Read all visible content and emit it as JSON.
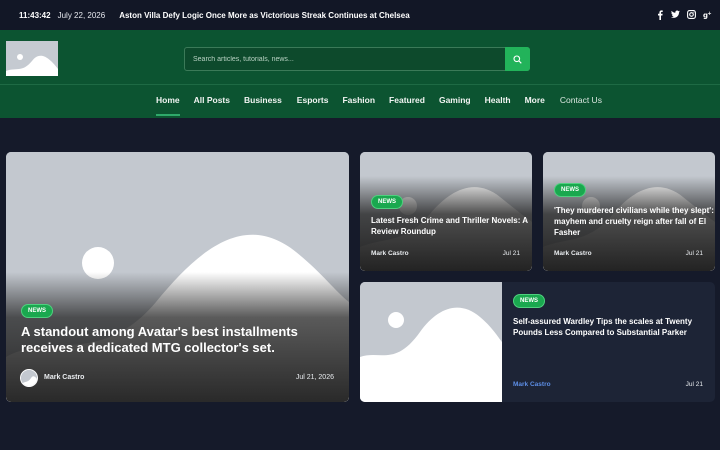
{
  "topbar": {
    "time": "11:43:42",
    "date": "July 22, 2026",
    "headline": "Aston Villa Defy Logic Once More as Victorious Streak Continues at Chelsea",
    "social_icons": [
      "facebook-icon",
      "twitter-icon",
      "instagram-icon",
      "google-plus-icon"
    ]
  },
  "search": {
    "placeholder": "Search articles, tutorials, news..."
  },
  "nav": {
    "items": [
      "Home",
      "All Posts",
      "Business",
      "Esports",
      "Fashion",
      "Featured",
      "Gaming",
      "Health",
      "More"
    ],
    "contact": "Contact Us",
    "active": "Home"
  },
  "colors": {
    "header": "#0c5431",
    "accent": "#1aa84f",
    "background": "#151a2a"
  },
  "featured": {
    "badge": "NEWS",
    "title": "A standout among Avatar's best installments receives a dedicated MTG collector's set.",
    "author": "Mark Castro",
    "date": "Jul 21, 2026"
  },
  "cards": [
    {
      "badge": "NEWS",
      "title": "Latest Fresh Crime and Thriller Novels: A Review Roundup",
      "author": "Mark Castro",
      "date": "Jul 21"
    },
    {
      "badge": "NEWS",
      "title": "'They murdered civilians while they slept': mayhem and cruelty reign after fall of El Fasher",
      "author": "Mark Castro",
      "date": "Jul 21"
    }
  ],
  "wide_card": {
    "badge": "NEWS",
    "title": "Self-assured Wardley Tips the scales at Twenty Pounds Less Compared to Substantial Parker",
    "author": "Mark Castro",
    "date": "Jul 21"
  }
}
